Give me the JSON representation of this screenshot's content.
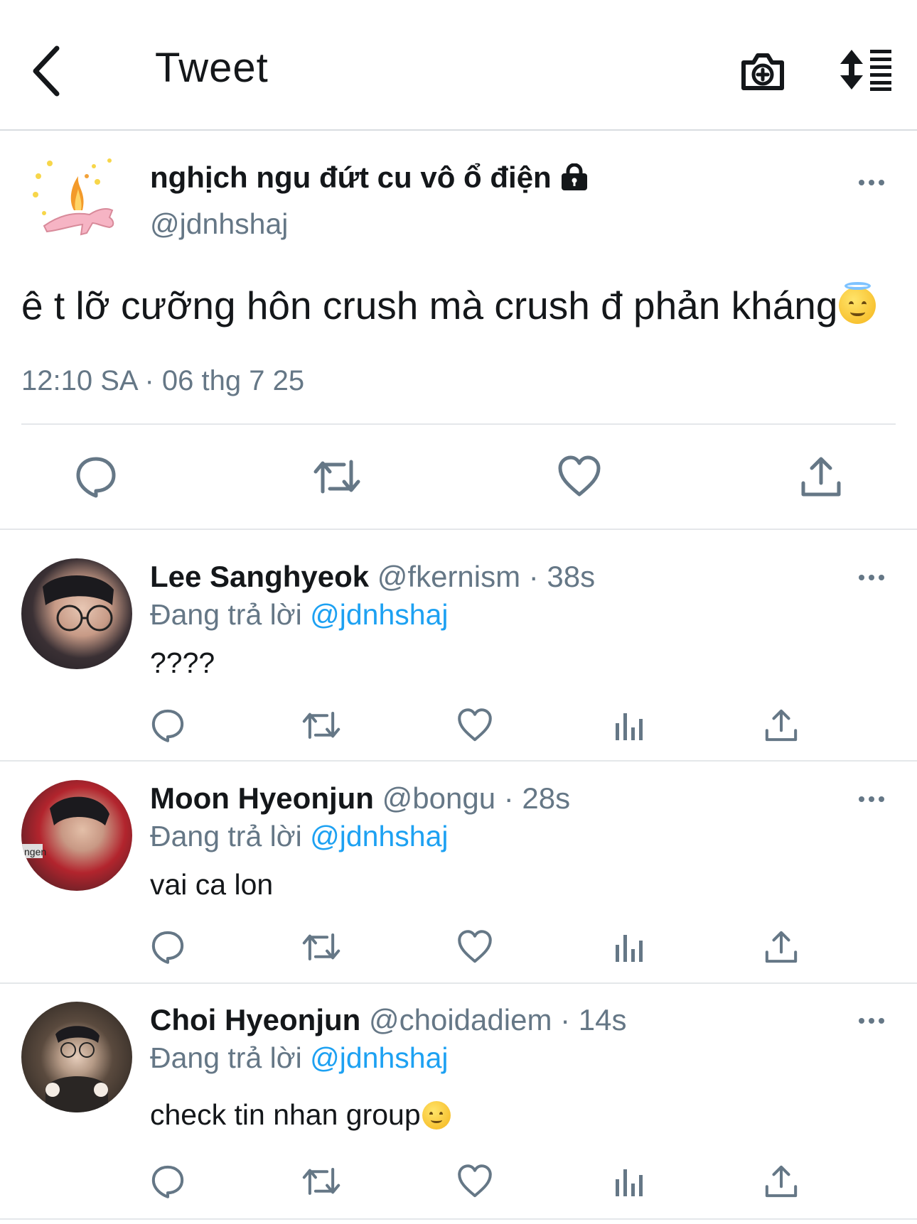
{
  "header": {
    "title": "Tweet",
    "back_icon": "chevron-left-icon",
    "camera_icon": "camera-plus-icon",
    "sort_icon": "sort-list-icon"
  },
  "main_tweet": {
    "display_name": "nghịch ngu đứt cu vô ổ điện",
    "handle": "@jdnhshaj",
    "text": "ê t lỡ cưỡng hôn crush mà crush đ phản kháng",
    "text_emoji": "smiling-face-with-halo",
    "timestamp": "12:10 SA · 06 thg 7 25",
    "actions": [
      "reply-icon",
      "retweet-icon",
      "like-icon",
      "share-icon"
    ]
  },
  "replies": [
    {
      "display_name": "Lee Sanghyeok",
      "handle": "@fkernism · 38s",
      "replying_prefix": "Đang trả lời ",
      "replying_to": "@jdnhshaj",
      "text": "????"
    },
    {
      "display_name": "Moon Hyeonjun",
      "handle": "@bongu · 28s",
      "replying_prefix": "Đang trả lời ",
      "replying_to": "@jdnhshaj",
      "text": "vai ca lon"
    },
    {
      "display_name": "Choi Hyeonjun",
      "handle": "@choidadiem · 14s",
      "replying_prefix": "Đang trả lời ",
      "replying_to": "@jdnhshaj",
      "text": "check tin nhan group",
      "text_emoji": "slightly-smiling-face"
    }
  ],
  "colors": {
    "link": "#1da1f2",
    "secondary_text": "#657786",
    "primary_text": "#14171a",
    "divider": "#e4e7ea"
  }
}
